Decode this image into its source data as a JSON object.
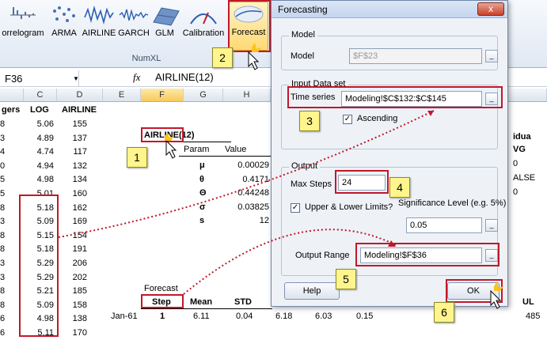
{
  "ribbon": {
    "buttons": [
      {
        "label": "orrelogram",
        "icon": "correlogram-icon"
      },
      {
        "label": "ARMA",
        "icon": "arma-icon"
      },
      {
        "label": "AIRLINE",
        "icon": "airline-icon"
      },
      {
        "label": "GARCH",
        "icon": "garch-icon"
      },
      {
        "label": "GLM",
        "icon": "glm-icon"
      },
      {
        "label": "Calibration",
        "icon": "calibration-icon"
      },
      {
        "label": "Forecast",
        "icon": "forecast-icon"
      }
    ],
    "group_label": "NumXL"
  },
  "formula_bar": {
    "name_box": "F36",
    "fx": "fx",
    "value": "AIRLINE(12)"
  },
  "sheet": {
    "columns": [
      "",
      "C",
      "D",
      "E",
      "F",
      "G",
      "H",
      "",
      "",
      "",
      "",
      ""
    ],
    "col_c_header": "LOG",
    "col_d_header": "AIRLINE",
    "partial_b_header": "gers",
    "col_b": [
      "8",
      "3",
      "4",
      "0",
      "5",
      "5",
      "8",
      "3",
      "8",
      "8",
      "3",
      "3",
      "8",
      "8",
      "6",
      "6"
    ],
    "col_c": [
      "5.06",
      "4.89",
      "4.74",
      "4.94",
      "4.98",
      "5.01",
      "5.18",
      "5.09",
      "5.15",
      "5.18",
      "5.29",
      "5.29",
      "5.21",
      "5.09",
      "4.98",
      "5.11"
    ],
    "col_d": [
      "155",
      "137",
      "117",
      "132",
      "134",
      "160",
      "162",
      "169",
      "154",
      "191",
      "206",
      "202",
      "185",
      "158",
      "138",
      "170"
    ],
    "airline_label": "AIRLINE(12)",
    "param_header": "Param",
    "value_header": "Value",
    "params": [
      {
        "sym": "μ",
        "val": "0.00029"
      },
      {
        "sym": "θ",
        "val": "0.4171"
      },
      {
        "sym": "Θ",
        "val": "0.44248"
      },
      {
        "sym": "σ",
        "val": "0.03825"
      },
      {
        "sym": "s",
        "val": "12"
      }
    ],
    "forecast_label": "Forecast",
    "forecast_headers": [
      "Step",
      "Mean",
      "STD"
    ],
    "forecast_row": {
      "date": "Jan-61",
      "step": "1",
      "mean": "6.11",
      "std": "0.04",
      "g": "6.18",
      "h": "6.03",
      "i": "0.15"
    },
    "right_edge": [
      "idua",
      "VG",
      "0",
      "ALSE",
      "0"
    ],
    "right_ul": "UL",
    "right_485": "485"
  },
  "dialog": {
    "title": "Forecasting",
    "close": "x",
    "model_legend": "Model",
    "model_label": "Model",
    "model_value": "$F$23",
    "input_legend": "Input Data set",
    "time_series_label": "Time series",
    "time_series_value": "Modeling!$C$132:$C$145",
    "ascending_label": "Ascending",
    "ascending_checked": true,
    "output_legend": "Output",
    "max_steps_label": "Max Steps",
    "max_steps_value": "24",
    "limits_label": "Upper & Lower Limits?",
    "limits_checked": true,
    "sig_label": "Significance Level (e.g. 5%)",
    "sig_value": "0.05",
    "output_range_label": "Output Range",
    "output_range_value": "Modeling!$F$36",
    "help_label": "Help",
    "ok_label": "OK"
  },
  "callouts": [
    "1",
    "2",
    "3",
    "4",
    "5",
    "6"
  ],
  "colors": {
    "accent_red": "#c0182a",
    "callout_yellow": "#fff58c",
    "title_blue": "#c4d5ee"
  }
}
